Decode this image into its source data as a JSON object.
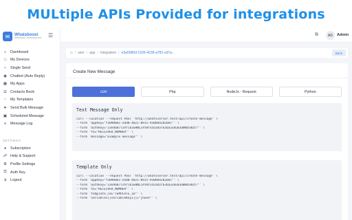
{
  "headline": "MULtiple APIs Provided for integrations",
  "brand": {
    "name": "Whatsboost",
    "tagline": "WhatsApp marketing tool"
  },
  "sidebar": {
    "items": [
      {
        "label": "Dashboard",
        "icon": "home-icon"
      },
      {
        "label": "My Devices",
        "icon": "phone-icon"
      },
      {
        "label": "Single Send",
        "icon": "message-icon"
      },
      {
        "label": "Chatbot (Auto Reply)",
        "icon": "chatbot-icon"
      },
      {
        "label": "My Apps",
        "icon": "apps-icon"
      },
      {
        "label": "Contacts Book",
        "icon": "contacts-icon"
      },
      {
        "label": "My Templates",
        "icon": "template-icon"
      },
      {
        "label": "Send Bulk Message",
        "icon": "send-icon"
      },
      {
        "label": "Scheduled Message",
        "icon": "calendar-icon"
      },
      {
        "label": "Message Log",
        "icon": "log-icon"
      }
    ],
    "section_label": "SETTINGS",
    "settings_items": [
      {
        "label": "Subscription",
        "icon": "subscription-icon"
      },
      {
        "label": "Help & Support",
        "icon": "help-icon"
      },
      {
        "label": "Profile Settings",
        "icon": "profile-icon"
      },
      {
        "label": "Auth Key",
        "icon": "key-icon"
      },
      {
        "label": "Logout",
        "icon": "logout-icon"
      }
    ]
  },
  "topbar": {
    "avatar_initials": "AD",
    "user_name": "Admin"
  },
  "breadcrumb": {
    "items": [
      "user",
      "app",
      "integration",
      "e3a5580d-1526-4239-a781-cd7a..."
    ],
    "back_label": "Back"
  },
  "card": {
    "title": "Create New Message",
    "tabs": [
      "cUrl",
      "Php",
      "NodeJs - Request",
      "Python"
    ],
    "active_tab": "cUrl",
    "sections": [
      {
        "title": "Text Message Only",
        "lines": [
          "curl --location --request POST 'http://whatsserver.test/api/create-message' \\",
          "--form 'appkey=\"f309086c-ead0-4821-8915-930b042026bc\"' \\",
          "--form 'authkey=\"33e4687TZVrib1EHNLiAY8Y3zOI8zr63Ua33du83dWO05dQt7\"' \\",
          "--form 'to=\"RECEIVER_NUMBER\"' \\",
          "--form 'message=\"Example message\"' \\"
        ]
      },
      {
        "title": "Template Only",
        "lines": [
          "curl --location --request POST 'http://whatsserver.test/api/create-message' \\",
          "--form 'appkey=\"f309086c-ead0-4821-8915-930b042026bc\"' \\",
          "--form 'authkey=\"33e4687TZVrib1EHNLiAY8Y3zOI8zr63Ua33du83dWO05dQt7\"' \\",
          "--form 'to=\"RECEIVER_NUMBER\"' \\",
          "--form 'template_id=\"TEMPLATE_ID\"' \\",
          "--form 'variables[{variableKey1}]=\"jhone\"' \\"
        ]
      }
    ]
  }
}
